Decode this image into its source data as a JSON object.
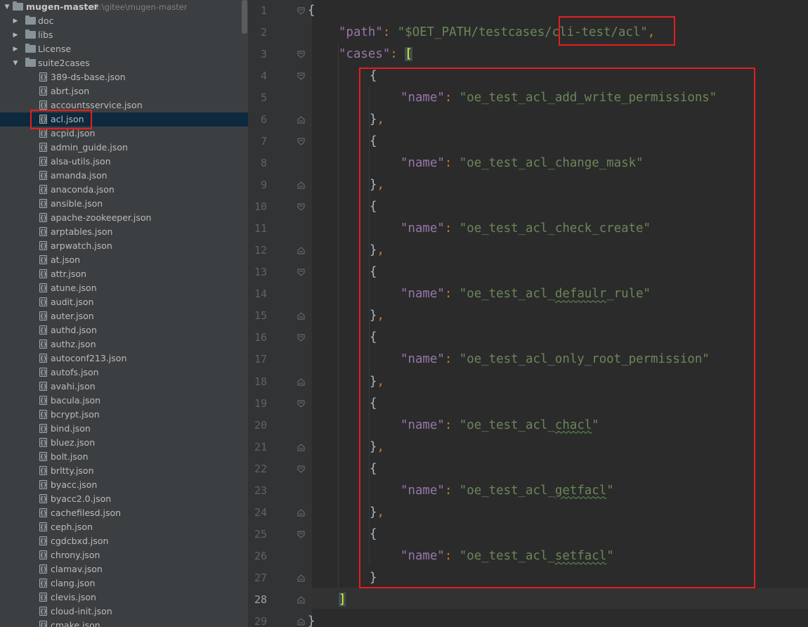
{
  "project": {
    "root_name": "mugen-master",
    "root_path": "G:\\gitee\\mugen-master",
    "folders": [
      "doc",
      "libs",
      "License"
    ],
    "open_folder": "suite2cases",
    "files": [
      "389-ds-base.json",
      "abrt.json",
      "accountsservice.json",
      "acl.json",
      "acpid.json",
      "admin_guide.json",
      "alsa-utils.json",
      "amanda.json",
      "anaconda.json",
      "ansible.json",
      "apache-zookeeper.json",
      "arptables.json",
      "arpwatch.json",
      "at.json",
      "attr.json",
      "atune.json",
      "audit.json",
      "auter.json",
      "authd.json",
      "authz.json",
      "autoconf213.json",
      "autofs.json",
      "avahi.json",
      "bacula.json",
      "bcrypt.json",
      "bind.json",
      "bluez.json",
      "bolt.json",
      "brltty.json",
      "byacc.json",
      "byacc2.0.json",
      "cachefilesd.json",
      "ceph.json",
      "cgdcbxd.json",
      "chrony.json",
      "clamav.json",
      "clang.json",
      "clevis.json",
      "cloud-init.json",
      "cmake.json"
    ],
    "selected_file": "acl.json"
  },
  "editor": {
    "line_numbers": [
      "1",
      "2",
      "3",
      "4",
      "5",
      "6",
      "7",
      "8",
      "9",
      "10",
      "11",
      "12",
      "13",
      "14",
      "15",
      "16",
      "17",
      "18",
      "19",
      "20",
      "21",
      "22",
      "23",
      "24",
      "25",
      "26",
      "27",
      "28",
      "29"
    ],
    "current_line": "28",
    "path_key": "\"path\"",
    "path_value_prefix": "\"$OET_PATH/testcases/",
    "path_value_tail": "cli-test/acl\"",
    "cases_key": "\"cases\"",
    "name_key": "\"name\"",
    "cases": [
      {
        "name": "\"oe_test_acl_add_write_permissions\""
      },
      {
        "name": "\"oe_test_acl_change_mask\""
      },
      {
        "name": "\"oe_test_acl_check_create\""
      },
      {
        "name_pre": "\"oe_test_acl_",
        "name_ul": "defaulr",
        "name_post": "_rule\""
      },
      {
        "name": "\"oe_test_acl_only_root_permission\""
      },
      {
        "name_pre": "\"oe_test_acl_",
        "name_ul": "chacl",
        "name_post": "\""
      },
      {
        "name_pre": "\"oe_test_acl_",
        "name_ul": "getfacl",
        "name_post": "\""
      },
      {
        "name_pre": "\"oe_test_acl_",
        "name_ul": "setfacl",
        "name_post": "\""
      }
    ]
  },
  "colors": {
    "annotation_red": "#e51e1e",
    "json_key": "#9876aa",
    "json_string": "#6a8759",
    "punctuation": "#cc7832",
    "selection": "#0d293e"
  }
}
